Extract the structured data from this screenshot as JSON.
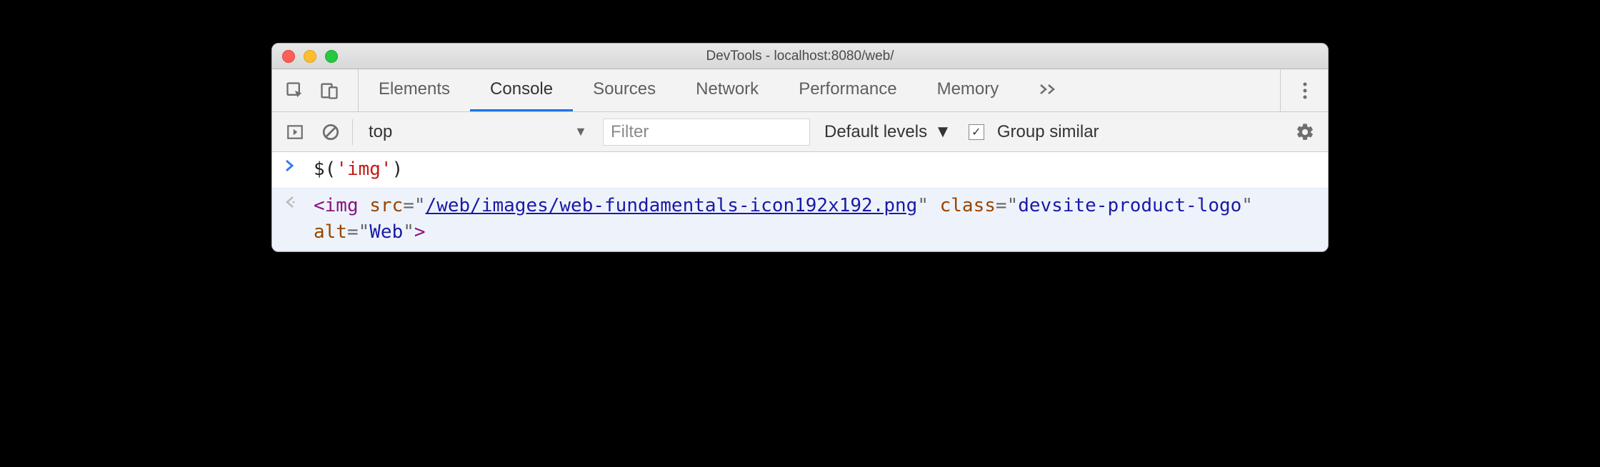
{
  "window": {
    "title": "DevTools - localhost:8080/web/"
  },
  "tabs": {
    "elements": "Elements",
    "console": "Console",
    "sources": "Sources",
    "network": "Network",
    "performance": "Performance",
    "memory": "Memory"
  },
  "toolbar": {
    "context": "top",
    "filter_placeholder": "Filter",
    "levels": "Default levels",
    "group_similar": "Group similar",
    "group_similar_checked": true
  },
  "console": {
    "input": {
      "fn": "$",
      "arg": "'img'"
    },
    "output": {
      "tag": "img",
      "src_attr": "src",
      "src_val": "/web/images/web-fundamentals-icon192x192.png",
      "class_attr": "class",
      "class_val": "devsite-product-logo",
      "alt_attr": "alt",
      "alt_val": "Web"
    }
  }
}
